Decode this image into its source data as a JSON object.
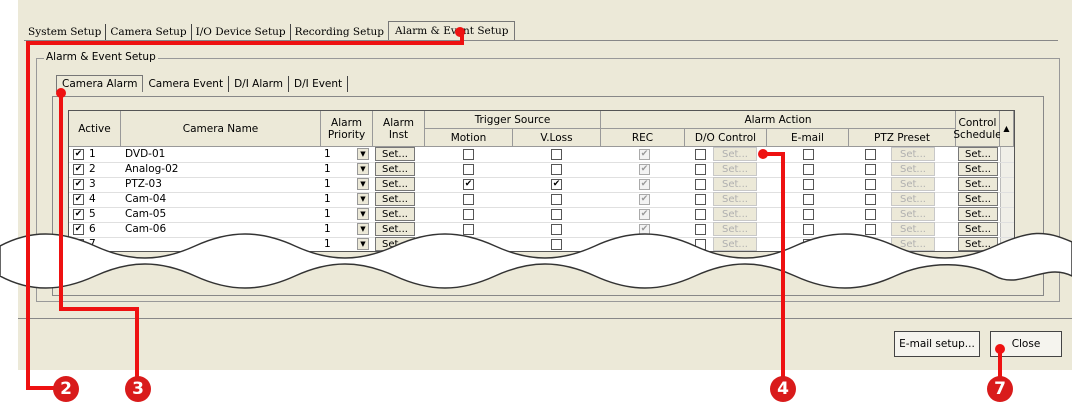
{
  "top_tabs": [
    {
      "label": "System Setup"
    },
    {
      "label": "Camera Setup"
    },
    {
      "label": "I/O Device Setup"
    },
    {
      "label": "Recording Setup"
    },
    {
      "label": "Alarm & Event Setup",
      "active": true
    }
  ],
  "group_label": "Alarm & Event Setup",
  "sub_tabs": [
    {
      "label": "Camera Alarm",
      "active": true
    },
    {
      "label": "Camera Event"
    },
    {
      "label": "D/I Alarm"
    },
    {
      "label": "D/I Event"
    }
  ],
  "table": {
    "headers": {
      "active": "Active",
      "camera_name": "Camera Name",
      "alarm_priority": "Alarm Priority",
      "alarm_inst": "Alarm Inst",
      "trigger_source": "Trigger Source",
      "motion": "Motion",
      "vloss": "V.Loss",
      "alarm_action": "Alarm Action",
      "rec": "REC",
      "do_control": "D/O Control",
      "email": "E-mail",
      "ptz_preset": "PTZ Preset",
      "control_schedule": "Control Schedule"
    },
    "set_label": "Set...",
    "rows": [
      {
        "num": "1",
        "name": "DVD-01",
        "priority": "1",
        "motion": false,
        "vloss": false
      },
      {
        "num": "2",
        "name": "Analog-02",
        "priority": "1",
        "motion": false,
        "vloss": false
      },
      {
        "num": "3",
        "name": "PTZ-03",
        "priority": "1",
        "motion": true,
        "vloss": true
      },
      {
        "num": "4",
        "name": "Cam-04",
        "priority": "1",
        "motion": false,
        "vloss": false
      },
      {
        "num": "5",
        "name": "Cam-05",
        "priority": "1",
        "motion": false,
        "vloss": false
      },
      {
        "num": "6",
        "name": "Cam-06",
        "priority": "1",
        "motion": false,
        "vloss": false
      },
      {
        "num": "7",
        "name": "",
        "priority": "1",
        "motion": false,
        "vloss": false
      }
    ]
  },
  "buttons": {
    "email_setup": "E-mail setup...",
    "close": "Close"
  },
  "callouts": [
    "2",
    "3",
    "4",
    "7"
  ],
  "colors": {
    "window_bg": "#ece9d8",
    "callout_red": "#d91b1b"
  }
}
